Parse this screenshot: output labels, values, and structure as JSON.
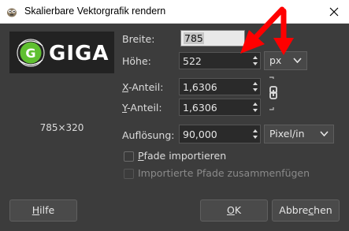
{
  "window": {
    "title": "Skalierbare Vektorgrafik rendern"
  },
  "preview": {
    "logo_letter": "G",
    "logo_text": "GIGA",
    "dimensions": "785×320"
  },
  "form": {
    "width_label": "Breite:",
    "width_value": "785",
    "height_label": "Höhe:",
    "height_value": "522",
    "unit": "px",
    "x_ratio_label_mnemonic": "X",
    "x_ratio_label_rest": "-Anteil:",
    "x_ratio_value": "1,6306",
    "y_ratio_label_mnemonic": "Y",
    "y_ratio_label_rest": "-Anteil:",
    "y_ratio_value": "1,6306",
    "resolution_label": "Auflösung:",
    "resolution_value": "90,000",
    "resolution_unit": "Pixel/in",
    "import_paths_mnemonic": "P",
    "import_paths_rest": "fade importieren",
    "merge_paths_label": "Importierte Pfade zusammenfügen"
  },
  "buttons": {
    "help_mnemonic": "H",
    "help_rest": "ilfe",
    "ok_mnemonic": "O",
    "ok_rest": "K",
    "cancel_pre": "Abbre",
    "cancel_mnemonic": "c",
    "cancel_post": "hen"
  },
  "colors": {
    "annotation_arrow": "#ff0000",
    "dialog_bg": "#3c3c3c",
    "logo_green": "#5fc030"
  }
}
